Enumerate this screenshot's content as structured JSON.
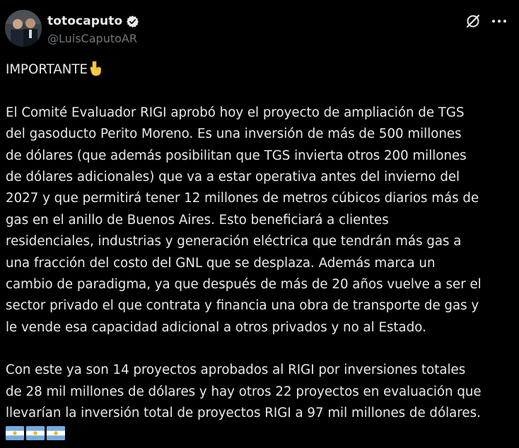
{
  "tweet": {
    "display_name": "totocaputo",
    "handle": "@LuisCaputoAR",
    "verified": true,
    "heading": "IMPORTANTE",
    "heading_emoji": "pointing-down",
    "paragraph1": [
      "El Comité Evaluador RIGI aprobó hoy el proyecto de ampliación de TGS",
      "del gasoducto Perito Moreno. Es una inversión de más de 500 millones",
      "de dólares (que además posibilitan que TGS invierta otros 200 millones",
      "de dólares adicionales) que va a estar operativa antes del invierno del",
      "2027 y que permitirá tener 12 millones de metros cúbicos diarios más de",
      "gas en el anillo de Buenos Aires. Esto beneficiará a clientes",
      "residenciales, industrias y generación eléctrica que tendrán más gas a",
      "una fracción del costo del GNL que se desplaza. Además marca un",
      "cambio de paradigma, ya que después de más de 20 años vuelve a ser el",
      "sector privado el que contrata y financia una obra de transporte de gas y",
      "le vende esa capacidad adicional a otros privados y no al Estado."
    ],
    "paragraph2": [
      "Con este ya son 14 proyectos aprobados al RIGI por inversiones totales",
      "de 28 mil millones de dólares y hay otros 22 proyectos en evaluación que",
      "llevarían la inversión total de proyectos RIGI a 97 mil millones de dólares."
    ],
    "flags": [
      "argentina-flag",
      "argentina-flag",
      "argentina-flag"
    ]
  },
  "icons": {
    "verified": "verified-badge-icon",
    "grok": "grok-icon",
    "more": "more-options-icon"
  },
  "colors": {
    "background": "#000000",
    "text": "#e7e9ea",
    "secondary_text": "#71767b",
    "verified_badge": "#e7e9ea",
    "flag_blue": "#74acdf"
  }
}
